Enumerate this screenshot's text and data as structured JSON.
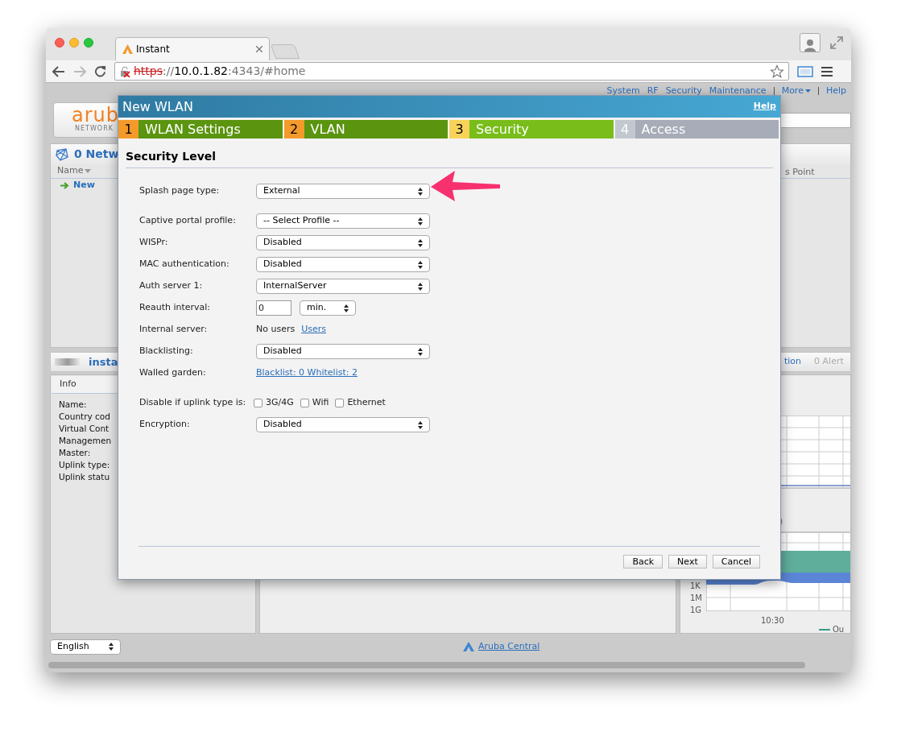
{
  "browser": {
    "tab_title": "Instant",
    "url": {
      "scheme": "https",
      "separator": "://",
      "host": "10.0.1.82",
      "rest": ":4343/#home"
    }
  },
  "top_nav": [
    {
      "label": "System",
      "menu": false
    },
    {
      "label": "RF",
      "menu": false
    },
    {
      "label": "Security",
      "menu": false
    },
    {
      "label": "Maintenance",
      "menu": false
    },
    {
      "label": "More",
      "menu": true
    },
    {
      "label": "Help",
      "menu": false
    }
  ],
  "logo": {
    "text": "arub",
    "subtext": "NETWORK"
  },
  "networks_panel": {
    "title": "0 Netw",
    "columns": [
      "Name",
      "s Point"
    ],
    "rows": [
      {
        "name": "New"
      }
    ]
  },
  "instant_panel": {
    "title": "insta",
    "link": "tion",
    "alerts": "0 Alert",
    "info_tab": "Info",
    "info_labels": [
      "Name:",
      "Country cod",
      "Virtual Cont",
      "Managemen",
      "Master:",
      "Uplink type:",
      "Uplink statu"
    ]
  },
  "chart_fragment": {
    "side_label": ")",
    "axis_labels": [
      "1K",
      "1M",
      "1G"
    ],
    "time_label": "10:30",
    "legend": "Ou"
  },
  "footer": {
    "language": "English",
    "link": "Aruba Central"
  },
  "dialog": {
    "title": "New WLAN",
    "help": "Help",
    "steps": [
      {
        "number": "1",
        "label": "WLAN Settings",
        "kind": "done"
      },
      {
        "number": "2",
        "label": "VLAN",
        "kind": "done"
      },
      {
        "number": "3",
        "label": "Security",
        "kind": "current"
      },
      {
        "number": "4",
        "label": "Access",
        "kind": "pending"
      }
    ],
    "section": "Security Level",
    "groups": [
      [
        {
          "kind": "select",
          "label": "Splash page type:",
          "value": "External"
        }
      ],
      [
        {
          "kind": "select",
          "label": "Captive portal profile:",
          "value": "-- Select Profile --"
        },
        {
          "kind": "select",
          "label": "WISPr:",
          "value": "Disabled"
        },
        {
          "kind": "select",
          "label": "MAC authentication:",
          "value": "Disabled"
        },
        {
          "kind": "select",
          "label": "Auth server 1:",
          "value": "InternalServer"
        },
        {
          "kind": "interval",
          "label": "Reauth interval:",
          "value": "0",
          "unit": "min."
        },
        {
          "kind": "text_link",
          "label": "Internal server:",
          "text": "No users",
          "link": "Users"
        },
        {
          "kind": "select",
          "label": "Blacklisting:",
          "value": "Disabled"
        },
        {
          "kind": "link",
          "label": "Walled garden:",
          "link": "Blacklist: 0 Whitelist: 2"
        }
      ],
      [
        {
          "kind": "checkboxes",
          "label": "Disable if uplink type is:",
          "options": [
            {
              "label": "3G/4G",
              "checked": false
            },
            {
              "label": "Wifi",
              "checked": false
            },
            {
              "label": "Ethernet",
              "checked": false
            }
          ]
        },
        {
          "kind": "select",
          "label": "Encryption:",
          "value": "Disabled"
        }
      ]
    ],
    "buttons": [
      "Back",
      "Next",
      "Cancel"
    ]
  }
}
